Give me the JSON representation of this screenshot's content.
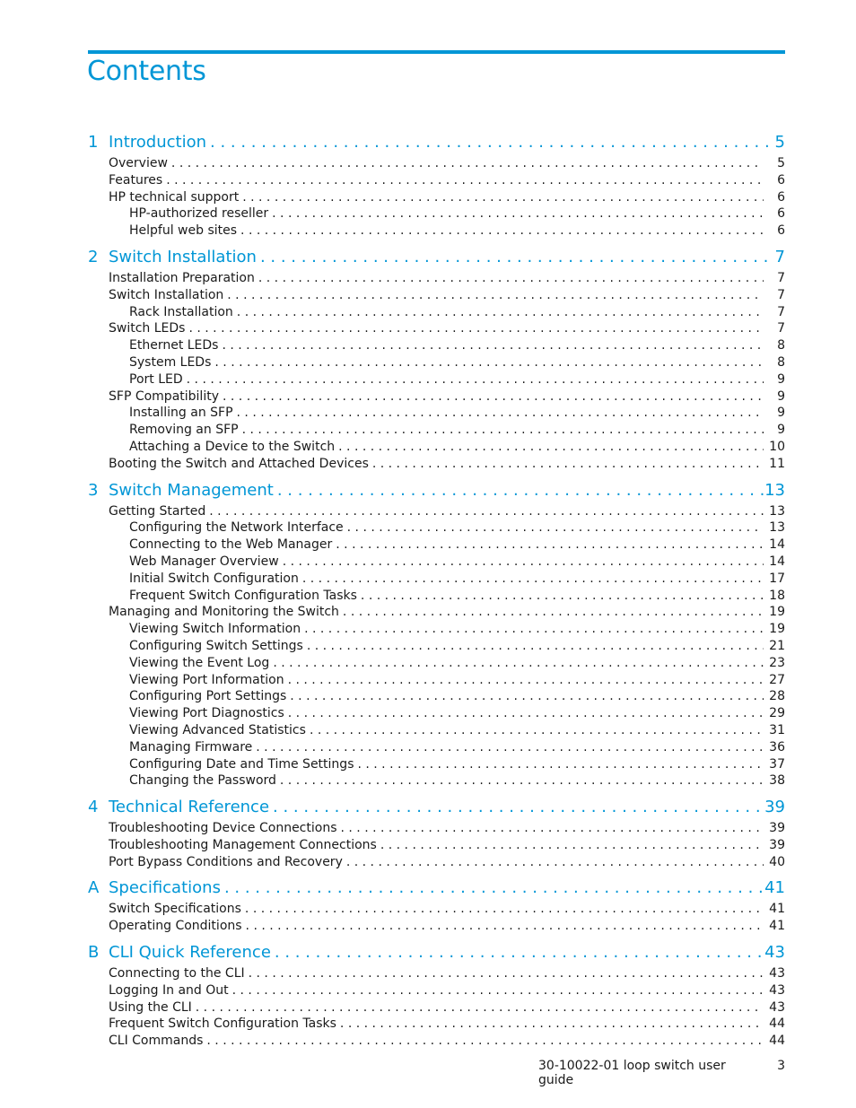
{
  "page": {
    "title": "Contents",
    "accent_color": "#0096d6"
  },
  "toc": [
    {
      "number": "1",
      "title": "Introduction",
      "page": "5",
      "entries": [
        {
          "level": 1,
          "title": "Overview",
          "page": "5"
        },
        {
          "level": 1,
          "title": "Features",
          "page": "6"
        },
        {
          "level": 1,
          "title": "HP technical support",
          "page": "6"
        },
        {
          "level": 2,
          "title": "HP-authorized reseller",
          "page": "6"
        },
        {
          "level": 2,
          "title": "Helpful web sites",
          "page": "6"
        }
      ]
    },
    {
      "number": "2",
      "title": "Switch Installation",
      "page": "7",
      "entries": [
        {
          "level": 1,
          "title": "Installation Preparation",
          "page": "7"
        },
        {
          "level": 1,
          "title": "Switch Installation",
          "page": "7"
        },
        {
          "level": 2,
          "title": "Rack Installation",
          "page": "7"
        },
        {
          "level": 1,
          "title": "Switch LEDs",
          "page": "7"
        },
        {
          "level": 2,
          "title": "Ethernet LEDs",
          "page": "8"
        },
        {
          "level": 2,
          "title": "System LEDs",
          "page": "8"
        },
        {
          "level": 2,
          "title": "Port LED",
          "page": "9"
        },
        {
          "level": 1,
          "title": "SFP Compatibility",
          "page": "9"
        },
        {
          "level": 2,
          "title": "Installing an SFP",
          "page": "9"
        },
        {
          "level": 2,
          "title": "Removing an SFP",
          "page": "9"
        },
        {
          "level": 2,
          "title": "Attaching a Device to the Switch",
          "page": "10"
        },
        {
          "level": 1,
          "title": "Booting the Switch and Attached Devices",
          "page": "11"
        }
      ]
    },
    {
      "number": "3",
      "title": "Switch Management",
      "page": "13",
      "entries": [
        {
          "level": 1,
          "title": "Getting Started",
          "page": "13"
        },
        {
          "level": 2,
          "title": "Configuring the Network Interface",
          "page": "13"
        },
        {
          "level": 2,
          "title": "Connecting to the Web Manager",
          "page": "14"
        },
        {
          "level": 2,
          "title": "Web Manager Overview",
          "page": "14"
        },
        {
          "level": 2,
          "title": "Initial Switch Configuration",
          "page": "17"
        },
        {
          "level": 2,
          "title": "Frequent Switch Configuration Tasks",
          "page": "18"
        },
        {
          "level": 1,
          "title": "Managing and Monitoring the Switch",
          "page": "19"
        },
        {
          "level": 2,
          "title": "Viewing Switch Information",
          "page": "19"
        },
        {
          "level": 2,
          "title": "Configuring Switch Settings",
          "page": "21"
        },
        {
          "level": 2,
          "title": "Viewing the Event Log",
          "page": "23"
        },
        {
          "level": 2,
          "title": "Viewing Port Information",
          "page": "27"
        },
        {
          "level": 2,
          "title": "Configuring Port Settings",
          "page": "28"
        },
        {
          "level": 2,
          "title": "Viewing Port Diagnostics",
          "page": "29"
        },
        {
          "level": 2,
          "title": "Viewing Advanced Statistics",
          "page": "31"
        },
        {
          "level": 2,
          "title": "Managing Firmware",
          "page": "36"
        },
        {
          "level": 2,
          "title": "Configuring Date and Time Settings",
          "page": "37"
        },
        {
          "level": 2,
          "title": "Changing the Password",
          "page": "38"
        }
      ]
    },
    {
      "number": "4",
      "title": "Technical Reference",
      "page": "39",
      "entries": [
        {
          "level": 1,
          "title": "Troubleshooting Device Connections",
          "page": "39"
        },
        {
          "level": 1,
          "title": "Troubleshooting Management Connections",
          "page": "39"
        },
        {
          "level": 1,
          "title": "Port Bypass Conditions and Recovery",
          "page": "40"
        }
      ]
    },
    {
      "number": "A",
      "title": "Specifications",
      "page": "41",
      "entries": [
        {
          "level": 1,
          "title": "Switch Specifications",
          "page": "41"
        },
        {
          "level": 1,
          "title": "Operating Conditions",
          "page": "41"
        }
      ]
    },
    {
      "number": "B",
      "title": "CLI Quick Reference",
      "page": "43",
      "entries": [
        {
          "level": 1,
          "title": "Connecting to the CLI",
          "page": "43"
        },
        {
          "level": 1,
          "title": "Logging In and Out",
          "page": "43"
        },
        {
          "level": 1,
          "title": "Using the CLI",
          "page": "43"
        },
        {
          "level": 1,
          "title": "Frequent Switch Configuration Tasks",
          "page": "44"
        },
        {
          "level": 1,
          "title": "CLI Commands",
          "page": "44"
        }
      ]
    }
  ],
  "footer": {
    "document_title": "30-10022-01 loop switch user guide",
    "page_number": "3"
  }
}
